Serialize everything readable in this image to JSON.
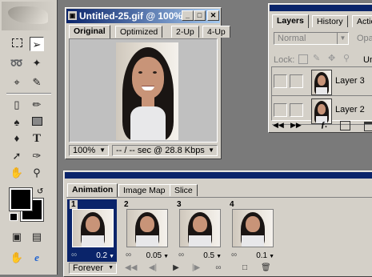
{
  "document_window": {
    "title": "Untitled-25.gif @ 100% (...",
    "tabs": [
      "Original",
      "Optimized",
      "2-Up",
      "4-Up"
    ],
    "zoom": "100%",
    "status": "-- / -- sec @ 28.8 Kbps"
  },
  "layers_panel": {
    "tabs": [
      "Layers",
      "History",
      "Actio"
    ],
    "blend_mode": "Normal",
    "opacity_label": "Opa",
    "lock_label": "Lock:",
    "lock_extra": "Un",
    "layers": [
      {
        "name": "Layer 3"
      },
      {
        "name": "Layer 2"
      }
    ]
  },
  "animation_panel": {
    "tabs": [
      "Animation",
      "Image Map",
      "Slice"
    ],
    "frames": [
      {
        "number": "1",
        "delay": "0.2"
      },
      {
        "number": "2",
        "delay": "0.05"
      },
      {
        "number": "3",
        "delay": "0.5"
      },
      {
        "number": "4",
        "delay": "0.1"
      }
    ],
    "loop": "Forever"
  },
  "toolbox": {
    "icons": [
      "marquee-icon",
      "move-icon",
      "lasso-icon",
      "magic-wand-icon",
      "crop-icon",
      "slice-icon",
      "eraser-icon",
      "brush-icon",
      "stamp-icon",
      "rectangle-icon",
      "bucket-icon",
      "type-icon",
      "eyedropper-icon",
      "hand-icon",
      "zoom-icon"
    ]
  }
}
